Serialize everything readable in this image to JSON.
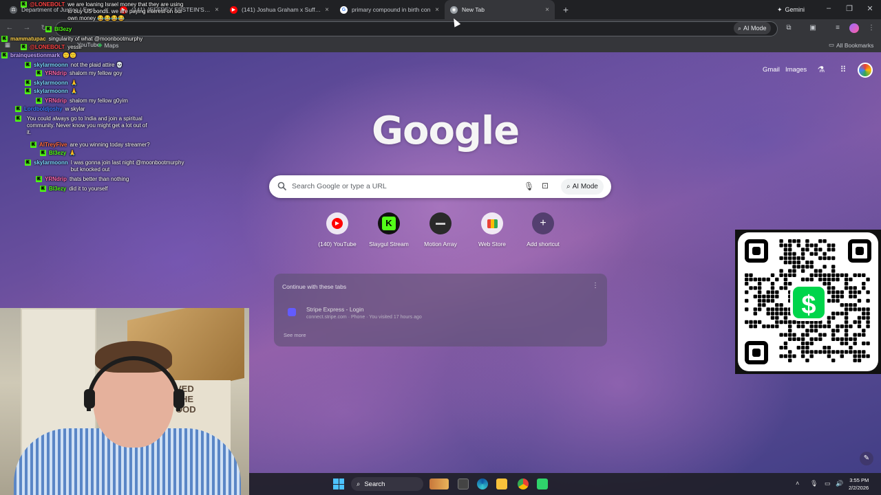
{
  "browser": {
    "tabs": [
      {
        "title": "Department of Justice | Epstein",
        "favicon_color": "#5f6368",
        "active": false
      },
      {
        "title": "(141) JEFFREY EPSTEIN'S FINAL",
        "favicon_color": "#ff0000",
        "active": false
      },
      {
        "title": "(141) Joshua Graham x Suffocat",
        "favicon_color": "#ff0000",
        "active": false
      },
      {
        "title": "primary compound in birth con",
        "favicon_color": "#ffffff",
        "active": false
      },
      {
        "title": "New Tab",
        "favicon_color": "#9aa0a6",
        "active": true
      }
    ],
    "new_tab_symbol": "+",
    "gemini_label": "Gemini",
    "omnibox_ai_label": "AI Mode",
    "bookmarks": [
      {
        "label": "YouTube",
        "icon": "youtube-icon"
      },
      {
        "label": "Maps",
        "icon": "maps-icon"
      }
    ],
    "all_bookmarks_label": "All Bookmarks"
  },
  "ntp": {
    "top_links": [
      "Gmail",
      "Images"
    ],
    "logo": "Google",
    "search_placeholder": "Search Google or type a URL",
    "ai_mode_label": "AI Mode",
    "shortcuts": [
      {
        "label": "(140) YouTube",
        "icon": "youtube-icon",
        "color": "#ff0000"
      },
      {
        "label": "Slaygul Stream",
        "icon": "kick-icon",
        "color": "#53fc18"
      },
      {
        "label": "Motion Array",
        "icon": "motion-array-icon",
        "color": "#222222"
      },
      {
        "label": "Web Store",
        "icon": "web-store-icon",
        "color": "#e94235"
      },
      {
        "label": "Add shortcut",
        "icon": "plus-icon",
        "color": "#5f6368"
      }
    ],
    "continue_card": {
      "title": "Continue with these tabs",
      "item_title": "Stripe Express - Login",
      "item_subtitle": "connect.stripe.com · Phone · You visited 17 hours ago",
      "see_more": "See more"
    }
  },
  "chat": [
    {
      "user": "@LONEBOLT",
      "color": "#ff4444",
      "message": "we are loaning Israel money that they are using to buy US bonds. we are paying interest on our own money 😂😂😂😂"
    },
    {
      "user": "Bl3ezy",
      "color": "#53fc18",
      "message": ""
    },
    {
      "user": "mammatupac",
      "color": "#ffd24a",
      "message": "singularity of what @moonbootmurphy"
    },
    {
      "user": "@LONEBOLT",
      "color": "#ff4444",
      "message": "yessir"
    },
    {
      "user": "brainquestionmark",
      "color": "#c9a8ff",
      "message": "🙂🙂"
    },
    {
      "user": "skylarmoonn",
      "color": "#7bd8ff",
      "message": "not the plaid attire 💀"
    },
    {
      "user": "YRNdrip",
      "color": "#ff66aa",
      "message": "shalom my fellow goy"
    },
    {
      "user": "skylarmoonn",
      "color": "#7bd8ff",
      "message": "🙏"
    },
    {
      "user": "skylarmoonn",
      "color": "#7bd8ff",
      "message": "🙏"
    },
    {
      "user": "YRNdrip",
      "color": "#ff66aa",
      "message": "shalom my fellow g0yim"
    },
    {
      "user": "Lordboldjoshy",
      "color": "#3d7bff",
      "message": "w skylar"
    },
    {
      "user": "",
      "color": "#ff4444",
      "message": "You could always go to India and join a spiritual community. Never know you might get a lot out of it."
    },
    {
      "user": "AlTreyFive",
      "color": "#ff6a3d",
      "message": "are you winning today streamer?"
    },
    {
      "user": "Bl3ezy",
      "color": "#53fc18",
      "message": "🙏"
    },
    {
      "user": "skylarmoonn",
      "color": "#7bd8ff",
      "message": "I was gonna join last night @moonbootmurphy but knocked out"
    },
    {
      "user": "YRNdrip",
      "color": "#ff66aa",
      "message": "thats better than nothing"
    },
    {
      "user": "Bl3ezy",
      "color": "#53fc18",
      "message": "did it to yourself"
    }
  ],
  "webcam": {
    "shirt_text": "VED\nTHE\nOOD"
  },
  "donation": {
    "symbol": "$",
    "brand_color": "#00d54b"
  },
  "taskbar": {
    "search_label": "Search",
    "time": "3:55 PM",
    "date": "2/2/2026"
  }
}
